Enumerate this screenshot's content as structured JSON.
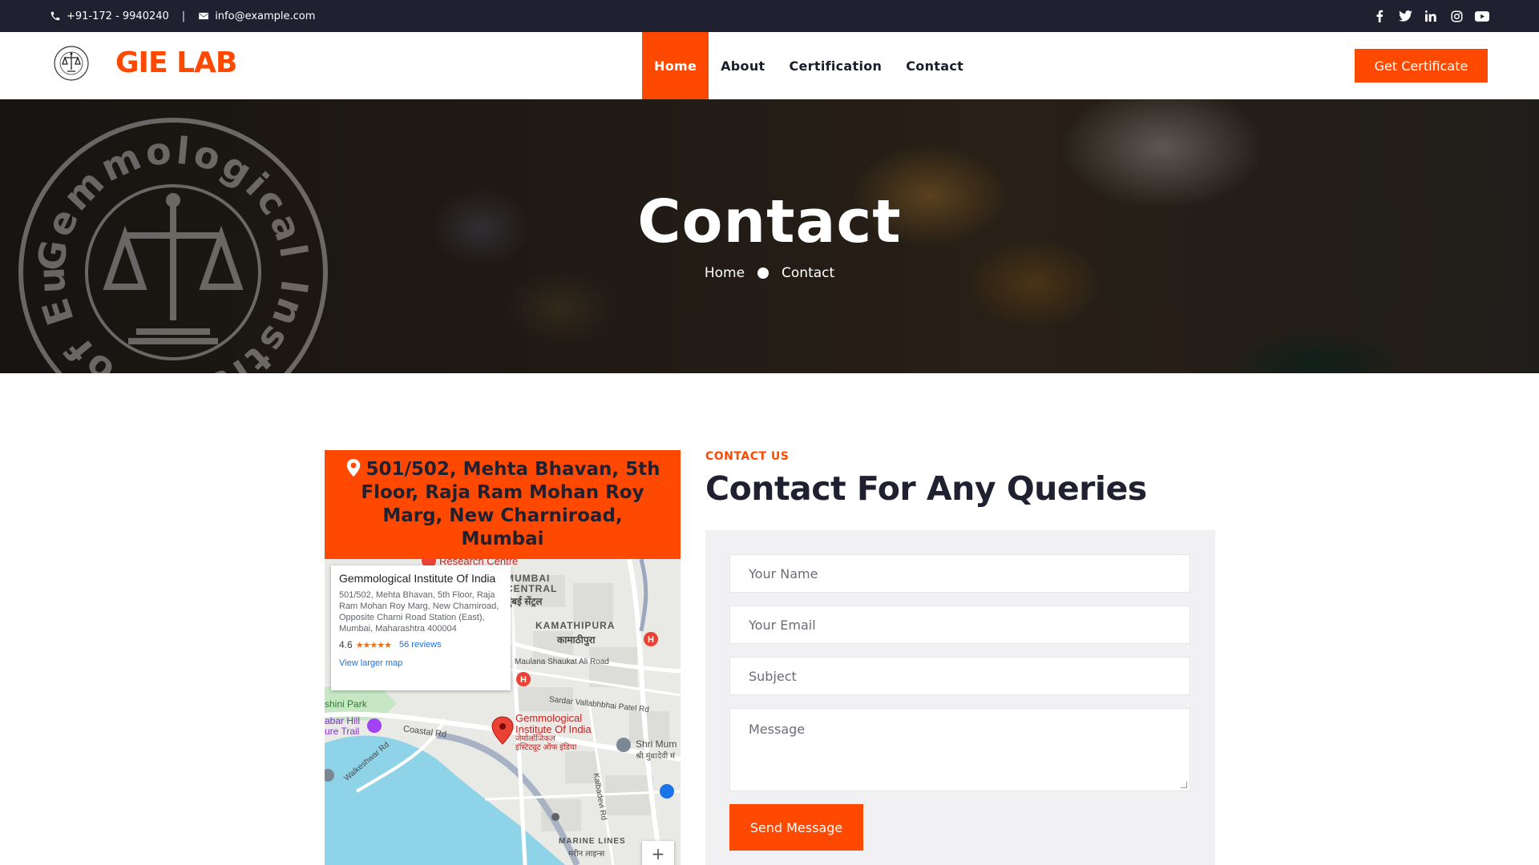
{
  "topbar": {
    "phone": "+91-172 - 9940240",
    "separator": "|",
    "email": "info@example.com",
    "socials": [
      "facebook-icon",
      "twitter-icon",
      "linkedin-icon",
      "instagram-icon",
      "youtube-icon"
    ]
  },
  "brand": {
    "name": "GIE LAB",
    "seal_text": "Gemmological Institute of Europe"
  },
  "nav": {
    "items": [
      {
        "label": "Home",
        "active": true
      },
      {
        "label": "About",
        "active": false
      },
      {
        "label": "Certification",
        "active": false
      },
      {
        "label": "Contact",
        "active": false
      }
    ],
    "cta": "Get Certificate"
  },
  "hero": {
    "title": "Contact",
    "breadcrumb": [
      "Home",
      "Contact"
    ]
  },
  "address_card": {
    "text": "501/502, Mehta Bhavan, 5th Floor, Raja Ram Mohan Roy Marg, New Charniroad, Mumbai"
  },
  "map": {
    "place_name": "Gemmological Institute Of India",
    "place_address": "501/502, Mehta Bhavan, 5th Floor, Raja Ram Mohan Roy Marg, New Charniroad, Opposite Charni Road Station (East), Mumbai, Maharashtra 400004",
    "rating": "4.6",
    "stars": "★★★★★",
    "reviews": "56 reviews",
    "larger_map": "View larger map",
    "zoom_in": "+",
    "labels": {
      "research": "Research Centre",
      "mumbai_central": "MUMBAI\nCENTRAL",
      "mumbai_central_dev": "मुंबई सेंट्रल",
      "kamathipura": "KAMATHIPURA",
      "kamathipura_dev": "कामाठीपुरा",
      "maulana": "Maulana Shaukat Ali Road",
      "sardar": "Sardar Vallabhbhai Patel Rd",
      "park": "shini Park",
      "hill": "abar Hill\nure Trail",
      "coastal": "Coastal Rd",
      "walkeshwar": "Walkeshwar Rd",
      "pin_label": "Gemmological\nInstitute Of India",
      "pin_label_dev": "जेमोलॉजिकल\nइंस्टिट्यूट ऑफ इंडिया",
      "shri": "Shri Mum",
      "shri_dev": "श्री मुंबादेवी मं",
      "kalbadevi": "Kalbadevi Rd",
      "marine": "MARINE LINES",
      "marine_dev": "मरीन लाइन्स"
    },
    "colors": {
      "water": "#8fd3e8",
      "land": "#e9e9e6",
      "road": "#ffffff",
      "park": "#c7e6c4",
      "pin": "#ea4335"
    }
  },
  "contact": {
    "eyebrow": "CONTACT US",
    "heading": "Contact For Any Queries",
    "name_placeholder": "Your Name",
    "email_placeholder": "Your Email",
    "subject_placeholder": "Subject",
    "message_placeholder": "Message",
    "submit": "Send Message"
  },
  "colors": {
    "accent": "#ff4800",
    "dark": "#1f2131",
    "form_bg": "#f1f1f3"
  }
}
